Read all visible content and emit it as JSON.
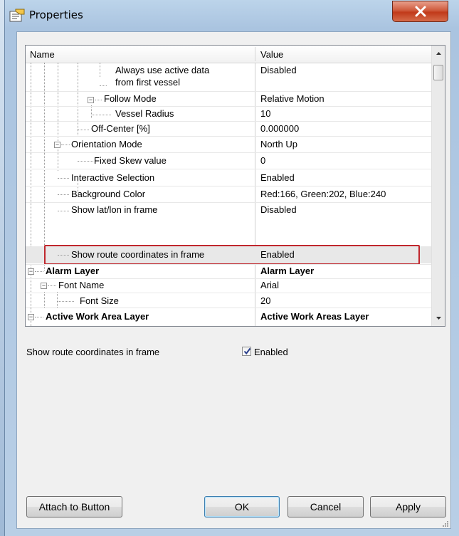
{
  "window": {
    "title": "Properties"
  },
  "grid": {
    "header": {
      "name": "Name",
      "value": "Value"
    },
    "rows": [
      {
        "name": "Always use active data",
        "name2": "from first vessel",
        "value": "Disabled"
      },
      {
        "name": "Follow Mode",
        "value": "Relative Motion"
      },
      {
        "name": "Vessel Radius",
        "value": "10"
      },
      {
        "name": "Off-Center [%]",
        "value": "0.000000"
      },
      {
        "name": "Orientation Mode",
        "value": "North Up"
      },
      {
        "name": "Fixed Skew value",
        "value": "0"
      },
      {
        "name": "Interactive Selection",
        "value": "Enabled"
      },
      {
        "name": "Background Color",
        "value": "Red:166, Green:202, Blue:240"
      },
      {
        "name": "Show lat/lon in frame",
        "value": "Disabled"
      },
      {
        "name": "Show route coordinates in frame",
        "value": "Enabled"
      },
      {
        "name": "Alarm Layer",
        "value": "Alarm Layer"
      },
      {
        "name": "Font Name",
        "value": "Arial"
      },
      {
        "name": "Font Size",
        "value": "20"
      },
      {
        "name": "Active Work Area Layer",
        "value": "Active Work Areas Layer"
      }
    ]
  },
  "detail": {
    "label": "Show route coordinates in frame",
    "checkbox_label": "Enabled",
    "checked": true
  },
  "buttons": {
    "attach": "Attach to Button",
    "ok": "OK",
    "cancel": "Cancel",
    "apply": "Apply"
  },
  "colors": {
    "highlight": "#c0272d",
    "close_button": "#c13a1a"
  }
}
